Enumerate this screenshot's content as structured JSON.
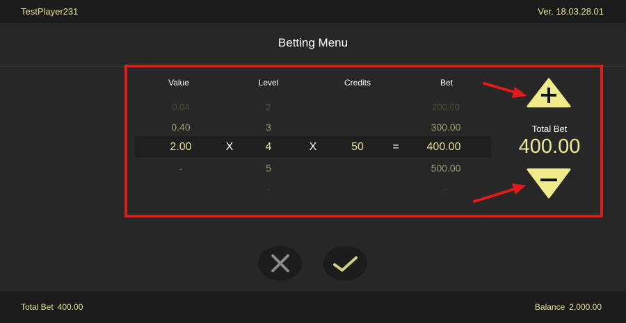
{
  "header": {
    "player": "TestPlayer231",
    "version": "Ver. 18.03.28.01"
  },
  "title": "Betting Menu",
  "columns": {
    "value": "Value",
    "level": "Level",
    "credits": "Credits",
    "bet": "Bet"
  },
  "rows": [
    {
      "value": "0.04",
      "level": "2",
      "bet": "200.00"
    },
    {
      "value": "0.40",
      "level": "3",
      "bet": "300.00"
    },
    {
      "value": "2.00",
      "level": "4",
      "credits": "50",
      "bet": "400.00"
    },
    {
      "value": "-",
      "level": "5",
      "bet": "500.00"
    },
    {
      "level": "-",
      "bet": "-"
    }
  ],
  "operators": {
    "multiply": "X",
    "equals": "="
  },
  "total_bet": {
    "label": "Total Bet",
    "value": "400.00"
  },
  "footer": {
    "total_label": "Total Bet",
    "total_value": "400.00",
    "balance_label": "Balance",
    "balance_value": "2,000.00"
  },
  "icons": {
    "increase": "plus-icon",
    "decrease": "minus-icon",
    "cancel": "close-icon",
    "confirm": "checkmark-icon"
  },
  "colors": {
    "accent": "#e8e08a",
    "button_fill": "#f0ec8c",
    "highlight": "#e11a1a"
  }
}
